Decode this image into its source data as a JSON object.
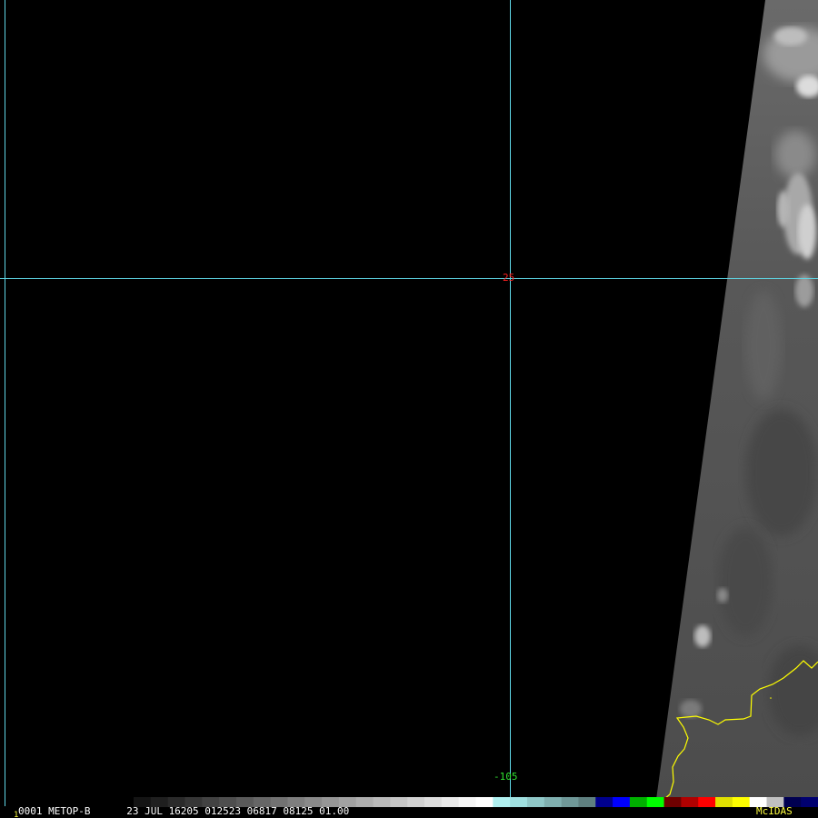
{
  "caption": {
    "index": "1",
    "text": "0001 METOP-B      23 JUL 16205 012523 06817 08125 01.00"
  },
  "brand": "McIDAS",
  "grid_labels": {
    "latitude": "25",
    "longitude": "-105"
  },
  "colors": {
    "background": "#000000",
    "grid": "#5fd7e6",
    "latitude_label": "#ff2020",
    "longitude_label": "#30e030",
    "caption_text": "#ffffff",
    "caption_index": "#ffff40",
    "brand": "#ffff40",
    "coastline": "#ffff00",
    "swath_base": "#4e4e4e"
  },
  "color_bar": [
    "#141414",
    "#1f1f1f",
    "#2a2a2a",
    "#363636",
    "#424242",
    "#4e4e4e",
    "#5a5a5a",
    "#666666",
    "#727272",
    "#7e7e7e",
    "#8a8a8a",
    "#969696",
    "#a2a2a2",
    "#aeaeae",
    "#bababa",
    "#c6c6c6",
    "#d2d2d2",
    "#dedede",
    "#eaeaea",
    "#f6f6f6",
    "#ffffff",
    "#b0f0f0",
    "#a0e0e0",
    "#90c8c8",
    "#80b0b0",
    "#6f9898",
    "#5f8080",
    "#00008c",
    "#0000ff",
    "#00b000",
    "#00ff00",
    "#6e0000",
    "#b00000",
    "#ff0000",
    "#e0e000",
    "#ffff00",
    "#ffffff",
    "#c0c0c0",
    "#000050",
    "#000070"
  ]
}
